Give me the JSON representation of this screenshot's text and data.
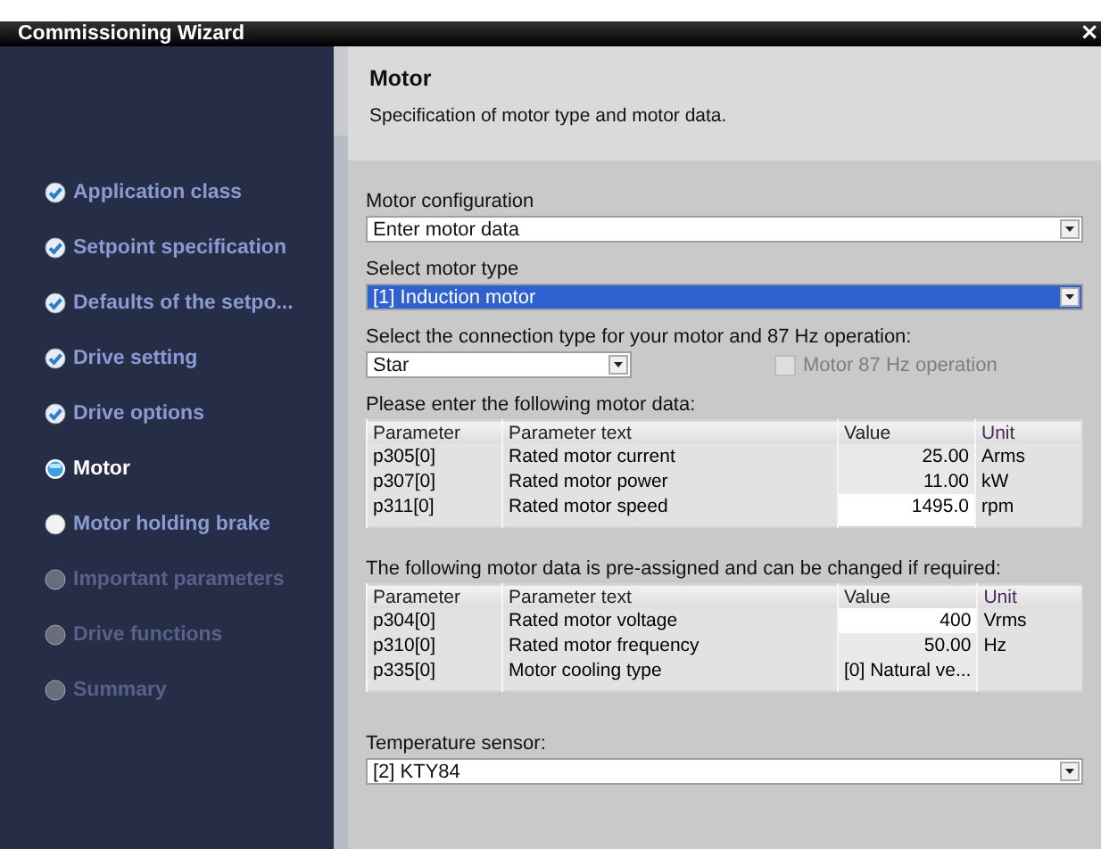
{
  "window": {
    "title": "Commissioning Wizard",
    "close": "×"
  },
  "steps": [
    {
      "label": "Application class",
      "kind": "done"
    },
    {
      "label": "Setpoint specification",
      "kind": "done"
    },
    {
      "label": "Defaults of the setpo...",
      "kind": "done"
    },
    {
      "label": "Drive setting",
      "kind": "done"
    },
    {
      "label": "Drive options",
      "kind": "done"
    },
    {
      "label": "Motor",
      "kind": "current"
    },
    {
      "label": "Motor holding brake",
      "kind": "pending"
    },
    {
      "label": "Important parameters",
      "kind": "disabled"
    },
    {
      "label": "Drive functions",
      "kind": "disabled"
    },
    {
      "label": "Summary",
      "kind": "disabled"
    }
  ],
  "header": {
    "title": "Motor",
    "description": "Specification of motor type and motor data."
  },
  "motor_configuration": {
    "label": "Motor configuration",
    "value": "Enter motor data",
    "focused": false
  },
  "motor_type": {
    "label": "Select motor type",
    "value": "[1] Induction motor",
    "focused": true
  },
  "connection": {
    "label": "Select the connection type for your motor and 87 Hz operation:",
    "value": "Star",
    "focused": false
  },
  "operation_87hz": {
    "label": "Motor 87 Hz operation",
    "checked": false,
    "disabled": true
  },
  "motor_data": {
    "label": "Please enter the following motor data:",
    "columns": [
      "Parameter",
      "Parameter text",
      "Value",
      "Unit"
    ],
    "rows": [
      {
        "parameter": "p305[0]",
        "text": "Rated motor current",
        "value": "25.00",
        "unit": "Arms",
        "editable": false
      },
      {
        "parameter": "p307[0]",
        "text": "Rated motor power",
        "value": "11.00",
        "unit": "kW",
        "editable": false
      },
      {
        "parameter": "p311[0]",
        "text": "Rated motor speed",
        "value": "1495.0",
        "unit": "rpm",
        "editable": true
      }
    ]
  },
  "preassigned_data": {
    "label": "The following motor data is pre-assigned and can be changed if required:",
    "columns": [
      "Parameter",
      "Parameter text",
      "Value",
      "Unit"
    ],
    "rows": [
      {
        "parameter": "p304[0]",
        "text": "Rated motor voltage",
        "value": "400",
        "unit": "Vrms",
        "editable": true
      },
      {
        "parameter": "p310[0]",
        "text": "Rated motor frequency",
        "value": "50.00",
        "unit": "Hz",
        "editable": false
      },
      {
        "parameter": "p335[0]",
        "text": "Motor cooling type",
        "value": "[0] Natural ve...",
        "editable": false
      }
    ]
  },
  "temperature_sensor": {
    "label": "Temperature sensor:",
    "value": "[2] KTY84",
    "focused": false
  }
}
